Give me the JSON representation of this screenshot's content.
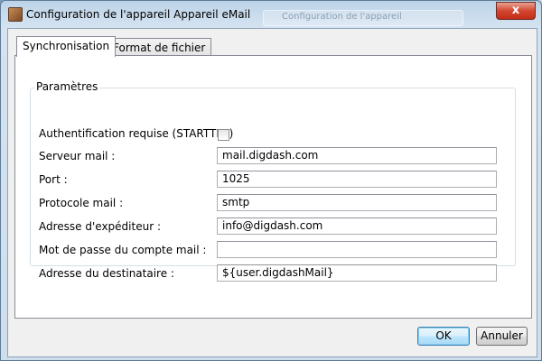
{
  "window": {
    "title": "Configuration de l'appareil Appareil eMail",
    "ghost_title": "Configuration de l'appareil",
    "close_label": "x"
  },
  "tabs": [
    {
      "label": "Synchronisation",
      "active": true
    },
    {
      "label": "Format de fichier",
      "active": false
    }
  ],
  "group": {
    "title": "Paramètres",
    "auth_label": "Authentification requise (STARTTLS)",
    "auth_checked": false,
    "fields": [
      {
        "label": "Serveur mail :",
        "value": "mail.digdash.com"
      },
      {
        "label": "Port :",
        "value": "1025"
      },
      {
        "label": "Protocole mail :",
        "value": "smtp"
      },
      {
        "label": "Adresse d'expéditeur :",
        "value": "info@digdash.com"
      },
      {
        "label": "Mot de passe du compte mail :",
        "value": ""
      },
      {
        "label": "Adresse du destinataire :",
        "value": "${user.digdashMail}"
      }
    ]
  },
  "buttons": {
    "ok": "OK",
    "cancel": "Annuler"
  }
}
